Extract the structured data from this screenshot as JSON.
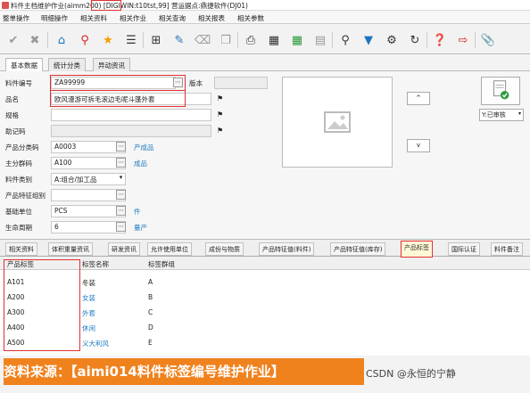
{
  "window": {
    "title": "料件主档维护作业(aimm200)    [DIGIWIN:t10tst,99]    营运据点:鼎捷软件(DJ01)"
  },
  "menu": [
    "整单操作",
    "明细操作",
    "相关资料",
    "相关作业",
    "相关查询",
    "相关报表",
    "相关参数"
  ],
  "toolbar_icons": [
    "check-circle-icon",
    "cancel-circle-icon",
    "home-icon",
    "location-pin-icon",
    "star-icon",
    "list-icon",
    "add-icon",
    "edit-icon",
    "delete-icon",
    "copy-icon",
    "print-icon",
    "print-preview-icon",
    "export-excel-icon",
    "export-icon",
    "search-icon",
    "filter-icon",
    "filter-advanced-icon",
    "refresh-icon",
    "help-icon",
    "exit-icon",
    "attachment-icon"
  ],
  "main_tabs": [
    "基本数据",
    "统计分类",
    "异动资讯"
  ],
  "form": {
    "item_no_label": "料件编号",
    "item_no": "ZA99999",
    "version_label": "版本",
    "name_label": "品名",
    "name": "欧风漫游可拆毛滚边毛呢斗篷外套",
    "spec_label": "规格",
    "spec": "",
    "mnemonic_label": "助记码",
    "mnemonic": "",
    "category_label": "产品分类码",
    "category": "A0003",
    "category_desc": "产成品",
    "group_label": "主分群码",
    "group": "A100",
    "group_desc": "成品",
    "item_type_label": "料件类别",
    "item_type": "A:组合/加工品",
    "feature_group_label": "产品特征组别",
    "feature_group": "",
    "base_unit_label": "基础单位",
    "base_unit": "PCS",
    "base_unit_desc": "件",
    "lifecycle_label": "生命周期",
    "lifecycle": "6",
    "lifecycle_desc": "量产"
  },
  "buttons": {
    "up": "^",
    "down": "v"
  },
  "status": "Y:已审核",
  "sub_tabs": [
    "相关资料",
    "体积重量资讯",
    "研发资讯",
    "允许使用单位",
    "成份与物质",
    "产品特征值(料件)",
    "产品特征值(库存)",
    "产品标签",
    "国际认证",
    "料件备注"
  ],
  "grid": {
    "headers": [
      "产品标签",
      "标签名称",
      "标签群组"
    ],
    "rows": [
      {
        "code": "A101",
        "name": "冬装",
        "group": "A"
      },
      {
        "code": "A200",
        "name": "女装",
        "group": "B"
      },
      {
        "code": "A300",
        "name": "外套",
        "group": "C"
      },
      {
        "code": "A400",
        "name": "休闲",
        "group": "D"
      },
      {
        "code": "A500",
        "name": "义大利风",
        "group": "E"
      }
    ]
  },
  "banner": "资料来源：【aimi014料件标签编号维护作业】",
  "watermark": "CSDN @永恒的宁静",
  "colors": {
    "highlight": "#e03030",
    "link": "#1f7ac0",
    "banner": "#f0821e"
  }
}
